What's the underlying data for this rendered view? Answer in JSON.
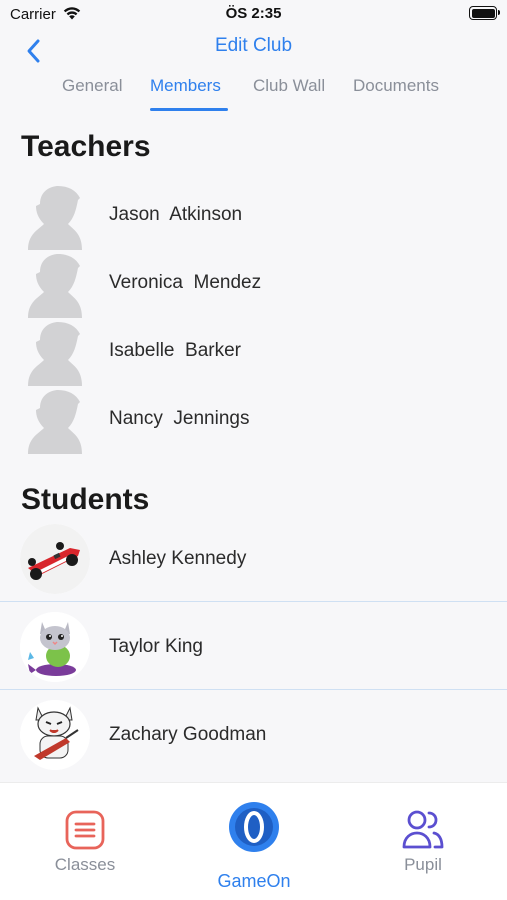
{
  "status_bar": {
    "carrier": "Carrier",
    "time": "ÖS 2:35"
  },
  "nav": {
    "title": "Edit Club"
  },
  "tabs": [
    {
      "label": "General"
    },
    {
      "label": "Members"
    },
    {
      "label": "Club Wall"
    },
    {
      "label": "Documents"
    }
  ],
  "active_tab": "Members",
  "teachers": {
    "title": "Teachers",
    "items": [
      {
        "name": "Jason  Atkinson"
      },
      {
        "name": "Veronica  Mendez"
      },
      {
        "name": "Isabelle  Barker"
      },
      {
        "name": "Nancy  Jennings"
      }
    ]
  },
  "students": {
    "title": "Students",
    "items": [
      {
        "name": "Ashley Kennedy",
        "avatar": "race-car-avatar"
      },
      {
        "name": "Taylor King",
        "avatar": "cat-on-fish-avatar"
      },
      {
        "name": "Zachary Goodman",
        "avatar": "cat-guitar-avatar"
      }
    ]
  },
  "tabbar": {
    "classes": "Classes",
    "gameon": "GameOn",
    "pupil": "Pupil"
  },
  "colors": {
    "accent": "#2f80ed",
    "classes_icon": "#e8645a",
    "pupil_icon": "#5b4fd0"
  }
}
